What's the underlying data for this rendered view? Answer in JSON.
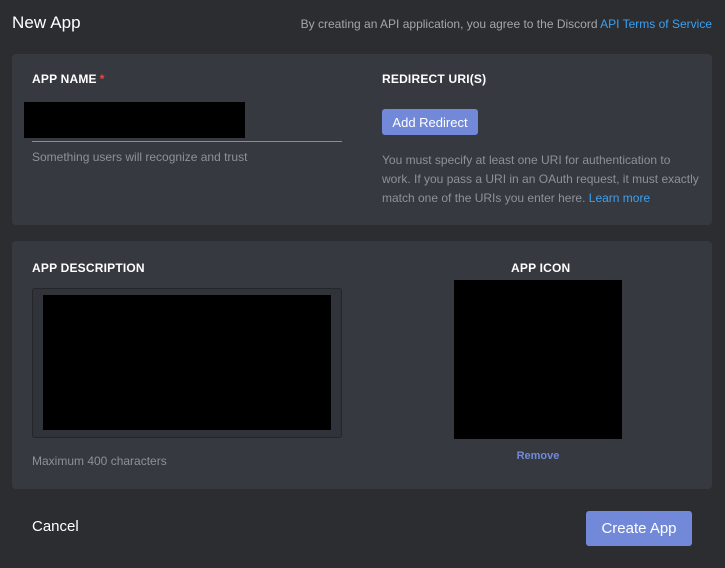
{
  "header": {
    "title": "New App",
    "agreement_text": "By creating an API application, you agree to the Discord ",
    "agreement_link": "API Terms of Service"
  },
  "app_name": {
    "label": "APP NAME",
    "required_marker": "*",
    "value": "",
    "hint": "Something users will recognize and trust"
  },
  "redirect": {
    "label": "REDIRECT URI(S)",
    "add_button": "Add Redirect",
    "help_text": "You must specify at least one URI for authentication to work. If you pass a URI in an OAuth request, it must exactly match one of the URIs you enter here. ",
    "learn_more": "Learn more"
  },
  "description": {
    "label": "APP DESCRIPTION",
    "value": "",
    "hint": "Maximum 400 characters"
  },
  "icon": {
    "label": "APP ICON",
    "remove": "Remove"
  },
  "footer": {
    "cancel": "Cancel",
    "create": "Create App"
  },
  "colors": {
    "background": "#2b2d31",
    "card": "#36393f",
    "accent": "#7289da",
    "link": "#3ba0f0",
    "input_focus": "#43b581",
    "required": "#f04747"
  }
}
